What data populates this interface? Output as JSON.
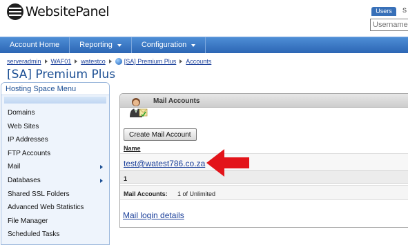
{
  "header": {
    "logo_text": "WebsitePanel",
    "users_tab": "Users",
    "users_tab_next": "S",
    "username_placeholder": "Username"
  },
  "nav": {
    "items": [
      {
        "label": "Account Home",
        "has_dropdown": false
      },
      {
        "label": "Reporting",
        "has_dropdown": true
      },
      {
        "label": "Configuration",
        "has_dropdown": true
      }
    ]
  },
  "breadcrumb": {
    "items": [
      "serveradmin",
      "WAF01",
      "watestco",
      "[SA] Premium Plus",
      "Accounts"
    ]
  },
  "page_title": "[SA] Premium Plus",
  "sidebar": {
    "title": "Hosting Space Menu",
    "items": [
      {
        "label": "Domains",
        "submenu": false
      },
      {
        "label": "Web Sites",
        "submenu": false
      },
      {
        "label": "IP Addresses",
        "submenu": false
      },
      {
        "label": "FTP Accounts",
        "submenu": false
      },
      {
        "label": "Mail",
        "submenu": true
      },
      {
        "label": "Databases",
        "submenu": true
      },
      {
        "label": "Shared SSL Folders",
        "submenu": false
      },
      {
        "label": "Advanced Web Statistics",
        "submenu": false
      },
      {
        "label": "File Manager",
        "submenu": false
      },
      {
        "label": "Scheduled Tasks",
        "submenu": false
      }
    ]
  },
  "panel": {
    "title": "Mail Accounts",
    "create_button": "Create Mail Account",
    "column_name": "Name",
    "accounts": [
      "test@watest786.co.za"
    ],
    "pager": "1",
    "count_label": "Mail Accounts:",
    "count_value": "1 of Unlimited",
    "login_link": "Mail login details"
  },
  "colors": {
    "nav_blue": "#2c66b4",
    "title_blue": "#1c4f94",
    "link_blue": "#1a3f9a",
    "annotation_red": "#e3141a"
  },
  "icons": {
    "logo": "globe-logo-icon",
    "panel": "mail-user-icon",
    "annotation": "red-arrow-icon"
  }
}
